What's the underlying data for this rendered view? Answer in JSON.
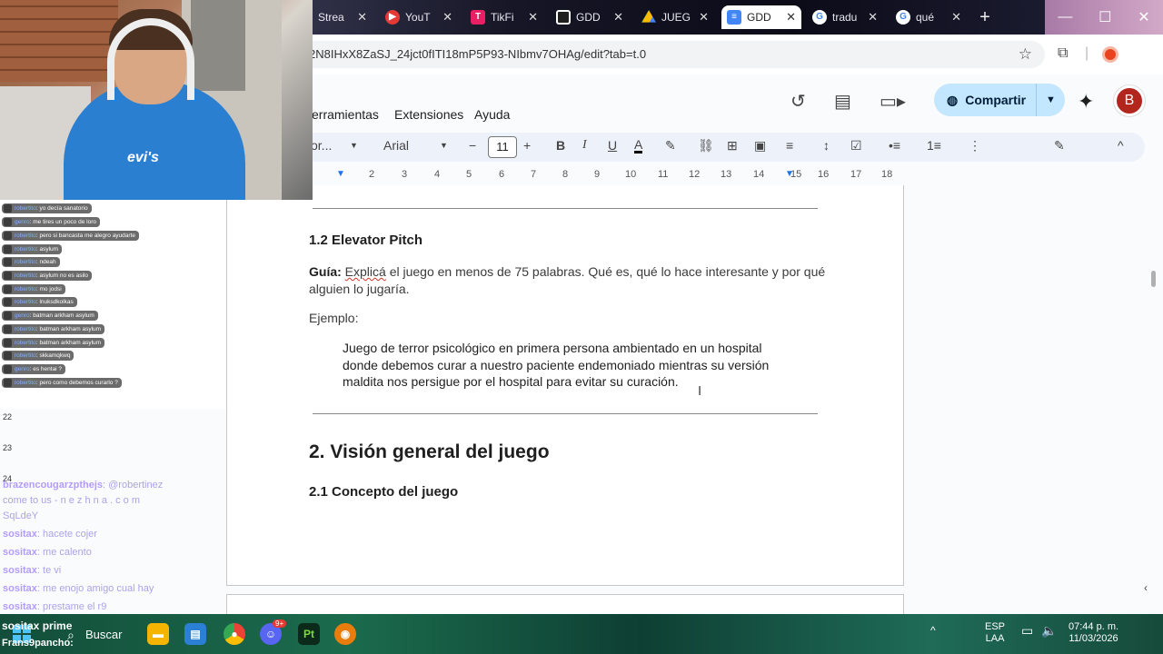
{
  "browser": {
    "tabs": [
      {
        "label": "Strea",
        "icon_color": "#7b5dd6",
        "icon": "twitch-icon"
      },
      {
        "label": "YouT",
        "icon_color": "#e53935",
        "icon": "youtube-icon"
      },
      {
        "label": "TikFi",
        "icon_color": "#e91e63",
        "icon": "tiktok-icon"
      },
      {
        "label": "GDD",
        "icon_color": "#0b5394",
        "icon": "trello-icon"
      },
      {
        "label": "JUEG",
        "icon_color": "#34a853",
        "icon": "drive-icon"
      },
      {
        "label": "GDD",
        "icon_color": "#4285f4",
        "icon": "docs-icon"
      },
      {
        "label": "tradu",
        "icon_color": "#ffffff",
        "icon": "google-icon"
      },
      {
        "label": "qué",
        "icon_color": "#ffffff",
        "icon": "google-icon"
      }
    ],
    "url": "2N8IHxX8ZaSJ_24jct0fITI18mP5P93-NIbmv7OHAg/edit?tab=t.0"
  },
  "docs": {
    "menu": [
      "erramientas",
      "Extensiones",
      "Ayuda"
    ],
    "share_label": "Compartir",
    "avatar_letter": "B",
    "toolbar": {
      "style": "or...",
      "font": "Arial",
      "font_size": "11"
    },
    "ruler_numbers": [
      "2",
      "3",
      "4",
      "5",
      "6",
      "7",
      "8",
      "9",
      "10",
      "11",
      "12",
      "13",
      "14",
      "15",
      "16",
      "17",
      "18"
    ]
  },
  "document": {
    "h_elevator": "1.2 Elevator Pitch",
    "guide_label": "Guía:",
    "guide_word": "Explicá",
    "guide_text": " el juego en menos de 75 palabras. Qué es, qué lo hace interesante y por qué alguien lo jugaría.",
    "example_label": "Ejemplo:",
    "example_text": "Juego de terror psicológico en primera persona ambientado en un hospital donde debemos curar a nuestro paciente endemoniado mientras su versión maldita nos persigue por el hospital para evitar su curación.",
    "h_vision": "2. Visión general del juego",
    "h_concept": "2.1 Concepto del juego"
  },
  "stream_overlay": {
    "chat_top": [
      {
        "user": "robertito",
        "msg": "yo decía sanatorio"
      },
      {
        "user": "genro",
        "msg": "me tires un poco de loro"
      },
      {
        "user": "robertito",
        "msg": "pero si bancasta me alegro ayudarte"
      },
      {
        "user": "robertito",
        "msg": "asylum"
      },
      {
        "user": "robertito",
        "msg": "ndeah"
      },
      {
        "user": "robertito",
        "msg": "asylum no es asilo"
      },
      {
        "user": "robertito",
        "msg": "mo jodsi"
      },
      {
        "user": "robertito",
        "msg": "lnuksdkolkas"
      },
      {
        "user": "genro",
        "msg": "batman arkham asylum"
      },
      {
        "user": "robertito",
        "msg": "batman arkham asylum"
      },
      {
        "user": "robertito",
        "msg": "batman arkham asylum"
      },
      {
        "user": "robertito",
        "msg": "skkamqkwq"
      },
      {
        "user": "genro",
        "msg": "es hentai ?"
      },
      {
        "user": "robertito",
        "msg": "pero como debemos curarlo ?"
      }
    ],
    "ruler_marks": [
      "22",
      "23",
      "24"
    ],
    "chat_bottom": [
      {
        "user": "brazencougarzpthejs",
        "msg": ": @robertinez"
      },
      {
        "user": "",
        "msg": "come to us - n e z h n a . c o m"
      },
      {
        "user": "",
        "msg": "SqLdeY"
      },
      {
        "user": "sositax",
        "msg": ": hacete cojer"
      },
      {
        "user": "sositax",
        "msg": ": me calento"
      },
      {
        "user": "sositax",
        "msg": ": te vi"
      },
      {
        "user": "sositax",
        "msg": ": me enojo amigo cual hay"
      },
      {
        "user": "sositax",
        "msg": ": prestame el r9"
      }
    ],
    "user_line_1": "sositax prime",
    "user_line_2": "Frans9pancho:"
  },
  "taskbar": {
    "search_label": "Buscar",
    "lang_1": "ESP",
    "lang_2": "LAA",
    "time": "07:44 p. m.",
    "date": "11/03/2026",
    "discord_badge": "9+"
  }
}
